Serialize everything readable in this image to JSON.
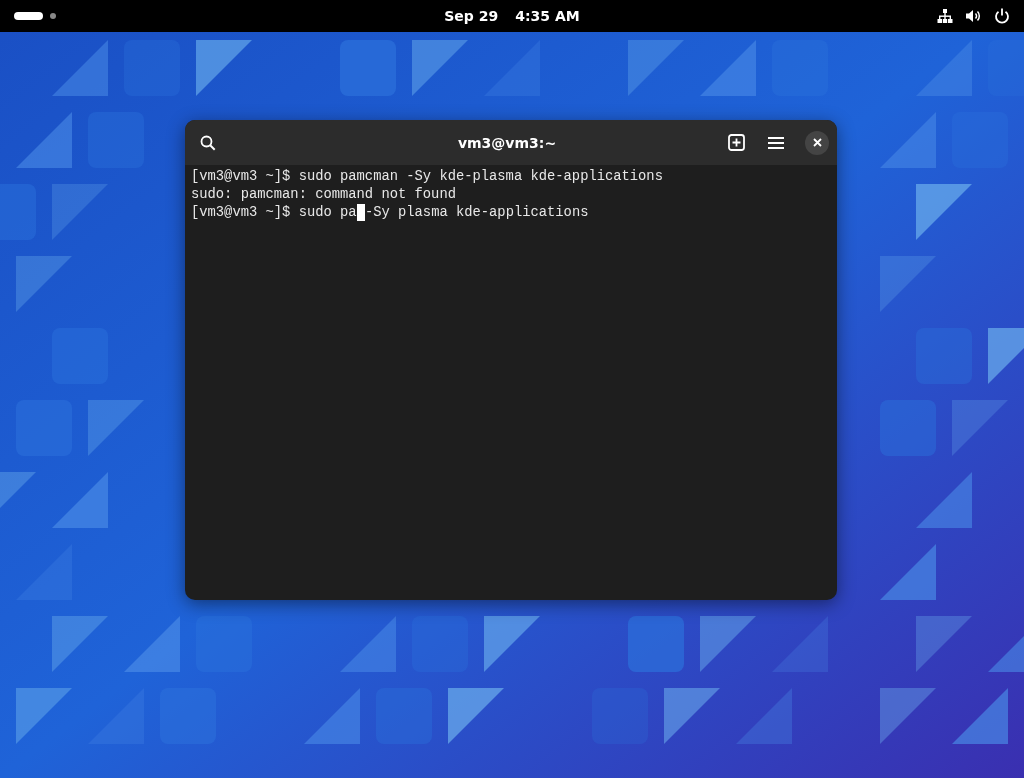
{
  "top_bar": {
    "date": "Sep 29",
    "time": "4:35 AM"
  },
  "terminal": {
    "title": "vm3@vm3:~",
    "lines": [
      {
        "kind": "output",
        "text": "[vm3@vm3 ~]$ sudo pamcman -Sy kde-plasma kde-applications"
      },
      {
        "kind": "output",
        "text": "sudo: pamcman: command not found"
      },
      {
        "kind": "input",
        "text": "[vm3@vm3 ~]$ sudo pa",
        "after_cursor": "-Sy plasma kde-applications"
      }
    ]
  }
}
